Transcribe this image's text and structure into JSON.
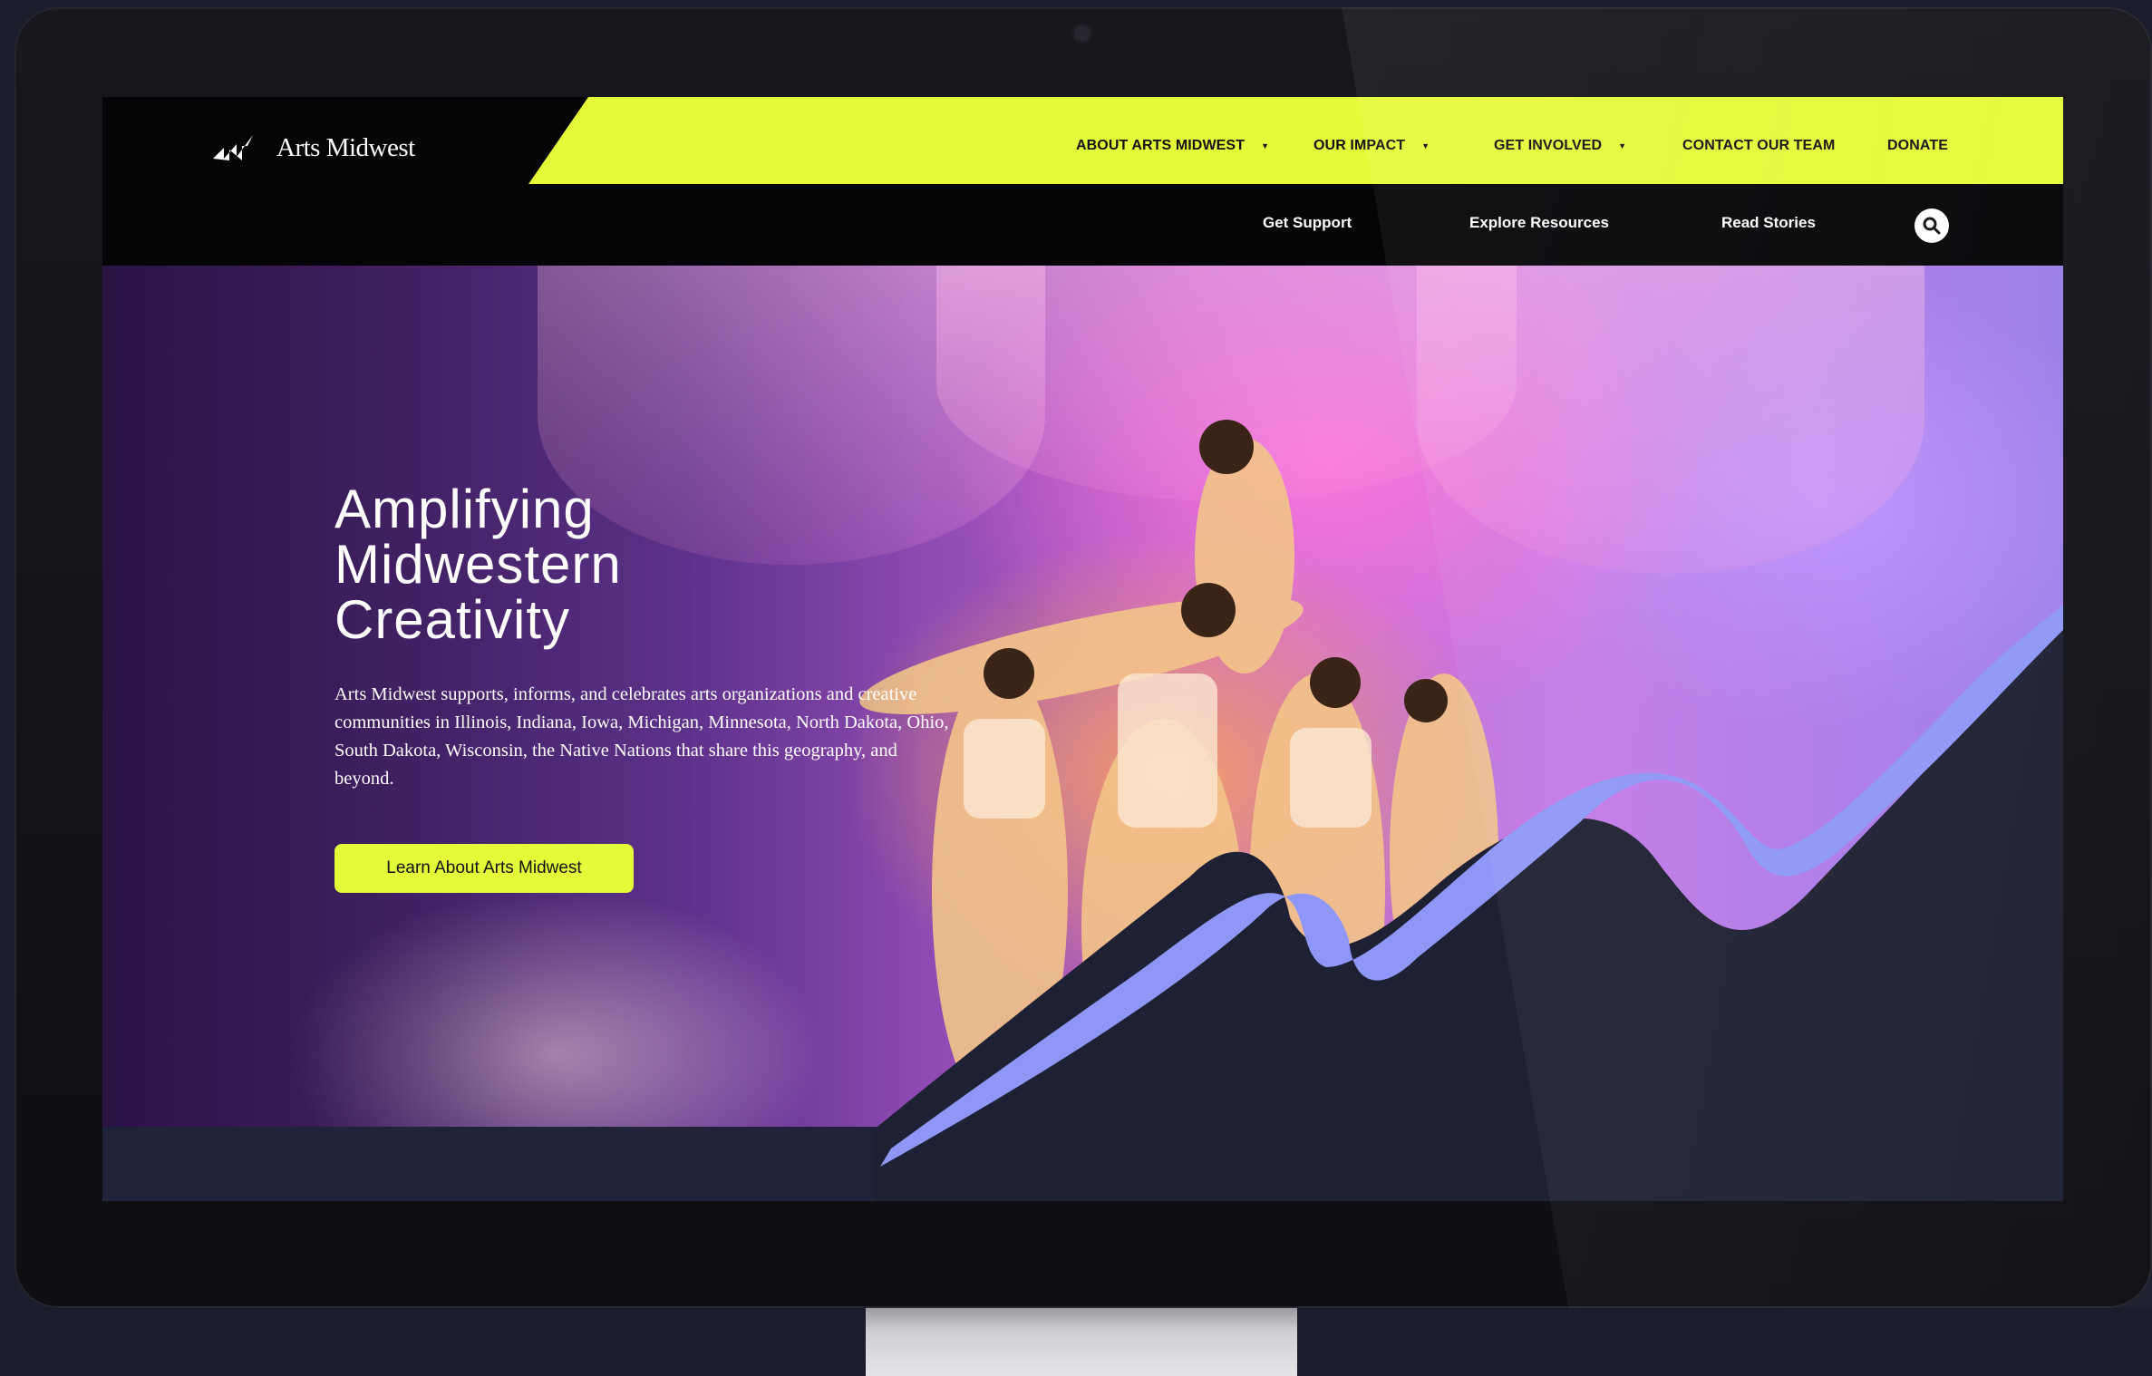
{
  "brand": {
    "name": "Arts Midwest",
    "accent": "#e4fb3a",
    "wave_color": "#8e97f6",
    "dark": "#050508"
  },
  "nav": {
    "main": [
      {
        "label": "ABOUT ARTS MIDWEST",
        "has_dropdown": true
      },
      {
        "label": "OUR IMPACT",
        "has_dropdown": true
      },
      {
        "label": "GET INVOLVED",
        "has_dropdown": true
      },
      {
        "label": "CONTACT OUR TEAM",
        "has_dropdown": false
      },
      {
        "label": "DONATE",
        "has_dropdown": false
      }
    ],
    "secondary": [
      {
        "label": "Get Support"
      },
      {
        "label": "Explore Resources"
      },
      {
        "label": "Read Stories"
      }
    ],
    "search_icon": "search-icon",
    "dropdown_icon": "caret-down-icon"
  },
  "hero": {
    "title_lines": [
      "Amplifying",
      "Midwestern",
      "Creativity"
    ],
    "body": "Arts Midwest supports, informs, and celebrates arts organizations and creative communities in Illinois, Indiana, Iowa, Michigan, Minnesota, North Dakota, Ohio, South Dakota, Wisconsin, the Native Nations that share this geography, and beyond.",
    "cta_label": "Learn About Arts Midwest"
  }
}
